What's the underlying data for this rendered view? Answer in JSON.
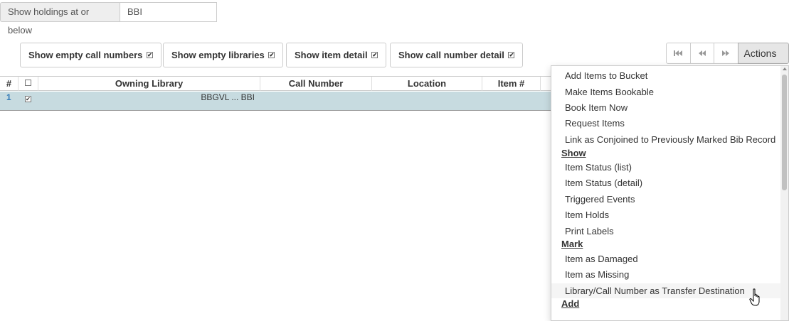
{
  "holdings": {
    "label": "Show holdings at or below",
    "value": "BBI"
  },
  "toggles": {
    "empty_call_numbers": "Show empty call numbers",
    "empty_libraries": "Show empty libraries",
    "item_detail": "Show item detail",
    "call_number_detail": "Show call number detail"
  },
  "pager": {
    "actions_label": "Actions"
  },
  "grid": {
    "columns": {
      "index": "#",
      "owning_library": "Owning Library",
      "call_number": "Call Number",
      "location": "Location",
      "item_num": "Item #"
    },
    "rows": [
      {
        "index": "1",
        "owning_library": "BBGVL ... BBI"
      }
    ]
  },
  "menu": {
    "items_top": [
      "Add Items to Bucket",
      "Make Items Bookable",
      "Book Item Now",
      "Request Items",
      "Link as Conjoined to Previously Marked Bib Record"
    ],
    "show_header": "Show",
    "show_items": [
      "Item Status (list)",
      "Item Status (detail)",
      "Triggered Events",
      "Item Holds",
      "Print Labels"
    ],
    "mark_header": "Mark",
    "mark_items": [
      "Item as Damaged",
      "Item as Missing",
      "Library/Call Number as Transfer Destination"
    ],
    "add_header": "Add"
  },
  "icons": {
    "first_page": "first-page-icon",
    "prev_page": "previous-page-icon",
    "next_page": "next-page-icon",
    "caret": "caret-down-icon",
    "cursor": "hand-pointer-icon"
  }
}
